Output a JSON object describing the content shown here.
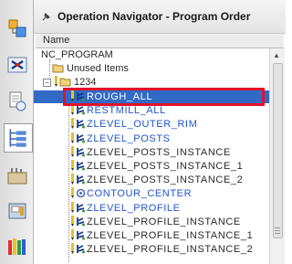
{
  "navigator": {
    "title": "Operation Navigator - Program Order",
    "column_header": "Name",
    "root": "NC_PROGRAM",
    "unused_items": "Unused Items",
    "program_group": "1234",
    "program_expander": "−"
  },
  "operations": [
    {
      "label": "ROUGH_ALL",
      "icon": "milling-operation-icon"
    },
    {
      "label": "RESTMILL_ALL",
      "icon": "milling-operation-icon"
    },
    {
      "label": "ZLEVEL_OUTER_RIM",
      "icon": "milling-operation-icon"
    },
    {
      "label": "ZLEVEL_POSTS",
      "icon": "milling-operation-icon"
    },
    {
      "label": "ZLEVEL_POSTS_INSTANCE",
      "icon": "milling-operation-icon"
    },
    {
      "label": "ZLEVEL_POSTS_INSTANCE_1",
      "icon": "milling-operation-icon"
    },
    {
      "label": "ZLEVEL_POSTS_INSTANCE_2",
      "icon": "milling-operation-icon"
    },
    {
      "label": "CONTOUR_CENTER",
      "icon": "contour-operation-icon"
    },
    {
      "label": "ZLEVEL_PROFILE",
      "icon": "milling-operation-icon"
    },
    {
      "label": "ZLEVEL_PROFILE_INSTANCE",
      "icon": "milling-operation-icon"
    },
    {
      "label": "ZLEVEL_PROFILE_INSTANCE_1",
      "icon": "milling-operation-icon"
    },
    {
      "label": "ZLEVEL_PROFILE_INSTANCE_2",
      "icon": "milling-operation-icon"
    }
  ],
  "selected_operation": "ROUGH_ALL",
  "colors": {
    "selection": "#316ac5",
    "highlight_box": "#e3122b",
    "blue_text": "#2255cc"
  },
  "toolbar_icons": [
    "assembly-navigator-icon",
    "constraint-navigator-icon",
    "part-navigator-icon",
    "operation-navigator-icon",
    "tool-library-icon",
    "machine-tool-icon",
    "palette-icon"
  ]
}
